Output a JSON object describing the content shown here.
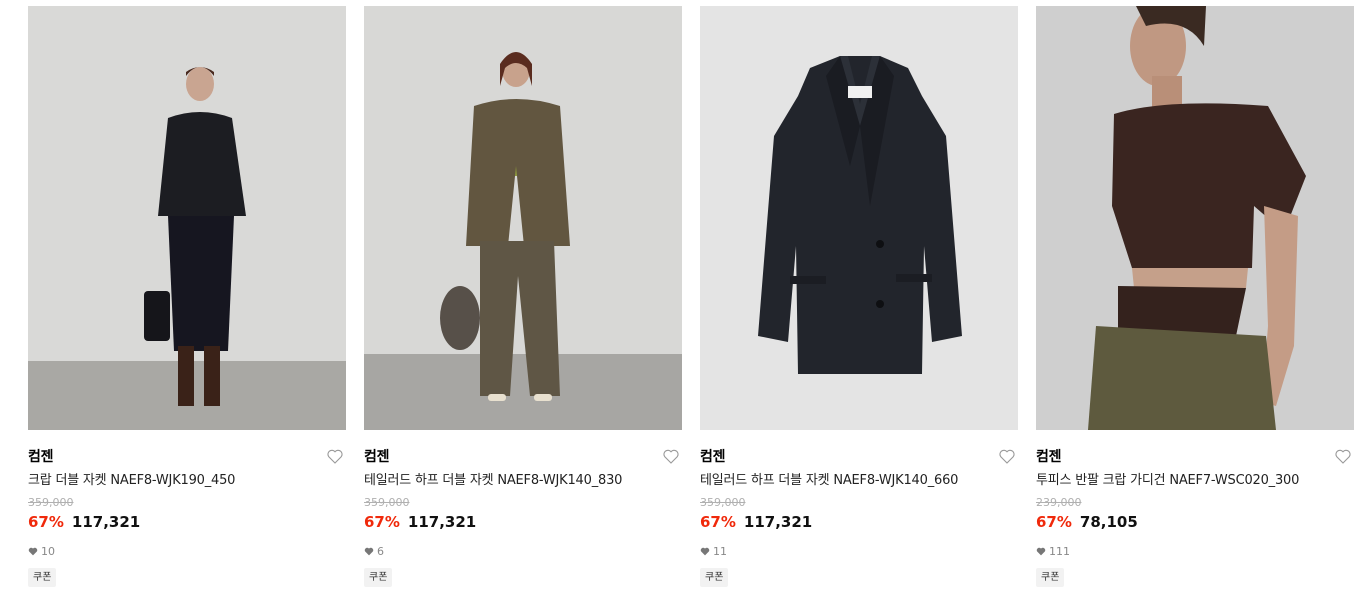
{
  "products": [
    {
      "brand": "컴젠",
      "title": "크랍 더블 자켓 NAEF8-WJK190_450",
      "original_price": "359,000",
      "discount": "67%",
      "price": "117,321",
      "likes": "10",
      "coupon_label": "쿠폰",
      "image_bg": "#d9d9d7",
      "image_desc_icon": "model-dark-jacket-skirt"
    },
    {
      "brand": "컴젠",
      "title": "테일러드 하프 더블 자켓 NAEF8-WJK140_830",
      "original_price": "359,000",
      "discount": "67%",
      "price": "117,321",
      "likes": "6",
      "coupon_label": "쿠폰",
      "image_bg": "#d8d8d6",
      "image_desc_icon": "model-brown-suit"
    },
    {
      "brand": "컴젠",
      "title": "테일러드 하프 더블 자켓 NAEF8-WJK140_660",
      "original_price": "359,000",
      "discount": "67%",
      "price": "117,321",
      "likes": "11",
      "coupon_label": "쿠폰",
      "image_bg": "#e4e4e4",
      "image_desc_icon": "navy-blazer-flat"
    },
    {
      "brand": "컴젠",
      "title": "투피스 반팔 크랍 가디건 NAEF7-WSC020_300",
      "original_price": "239,000",
      "discount": "67%",
      "price": "78,105",
      "likes": "111",
      "coupon_label": "쿠폰",
      "image_bg": "#cfcfcf",
      "image_desc_icon": "model-brown-cardigan"
    }
  ],
  "colors": {
    "discount": "#f0290b",
    "strike": "#b0b0b0",
    "coupon_bg": "#f2f2f2"
  }
}
